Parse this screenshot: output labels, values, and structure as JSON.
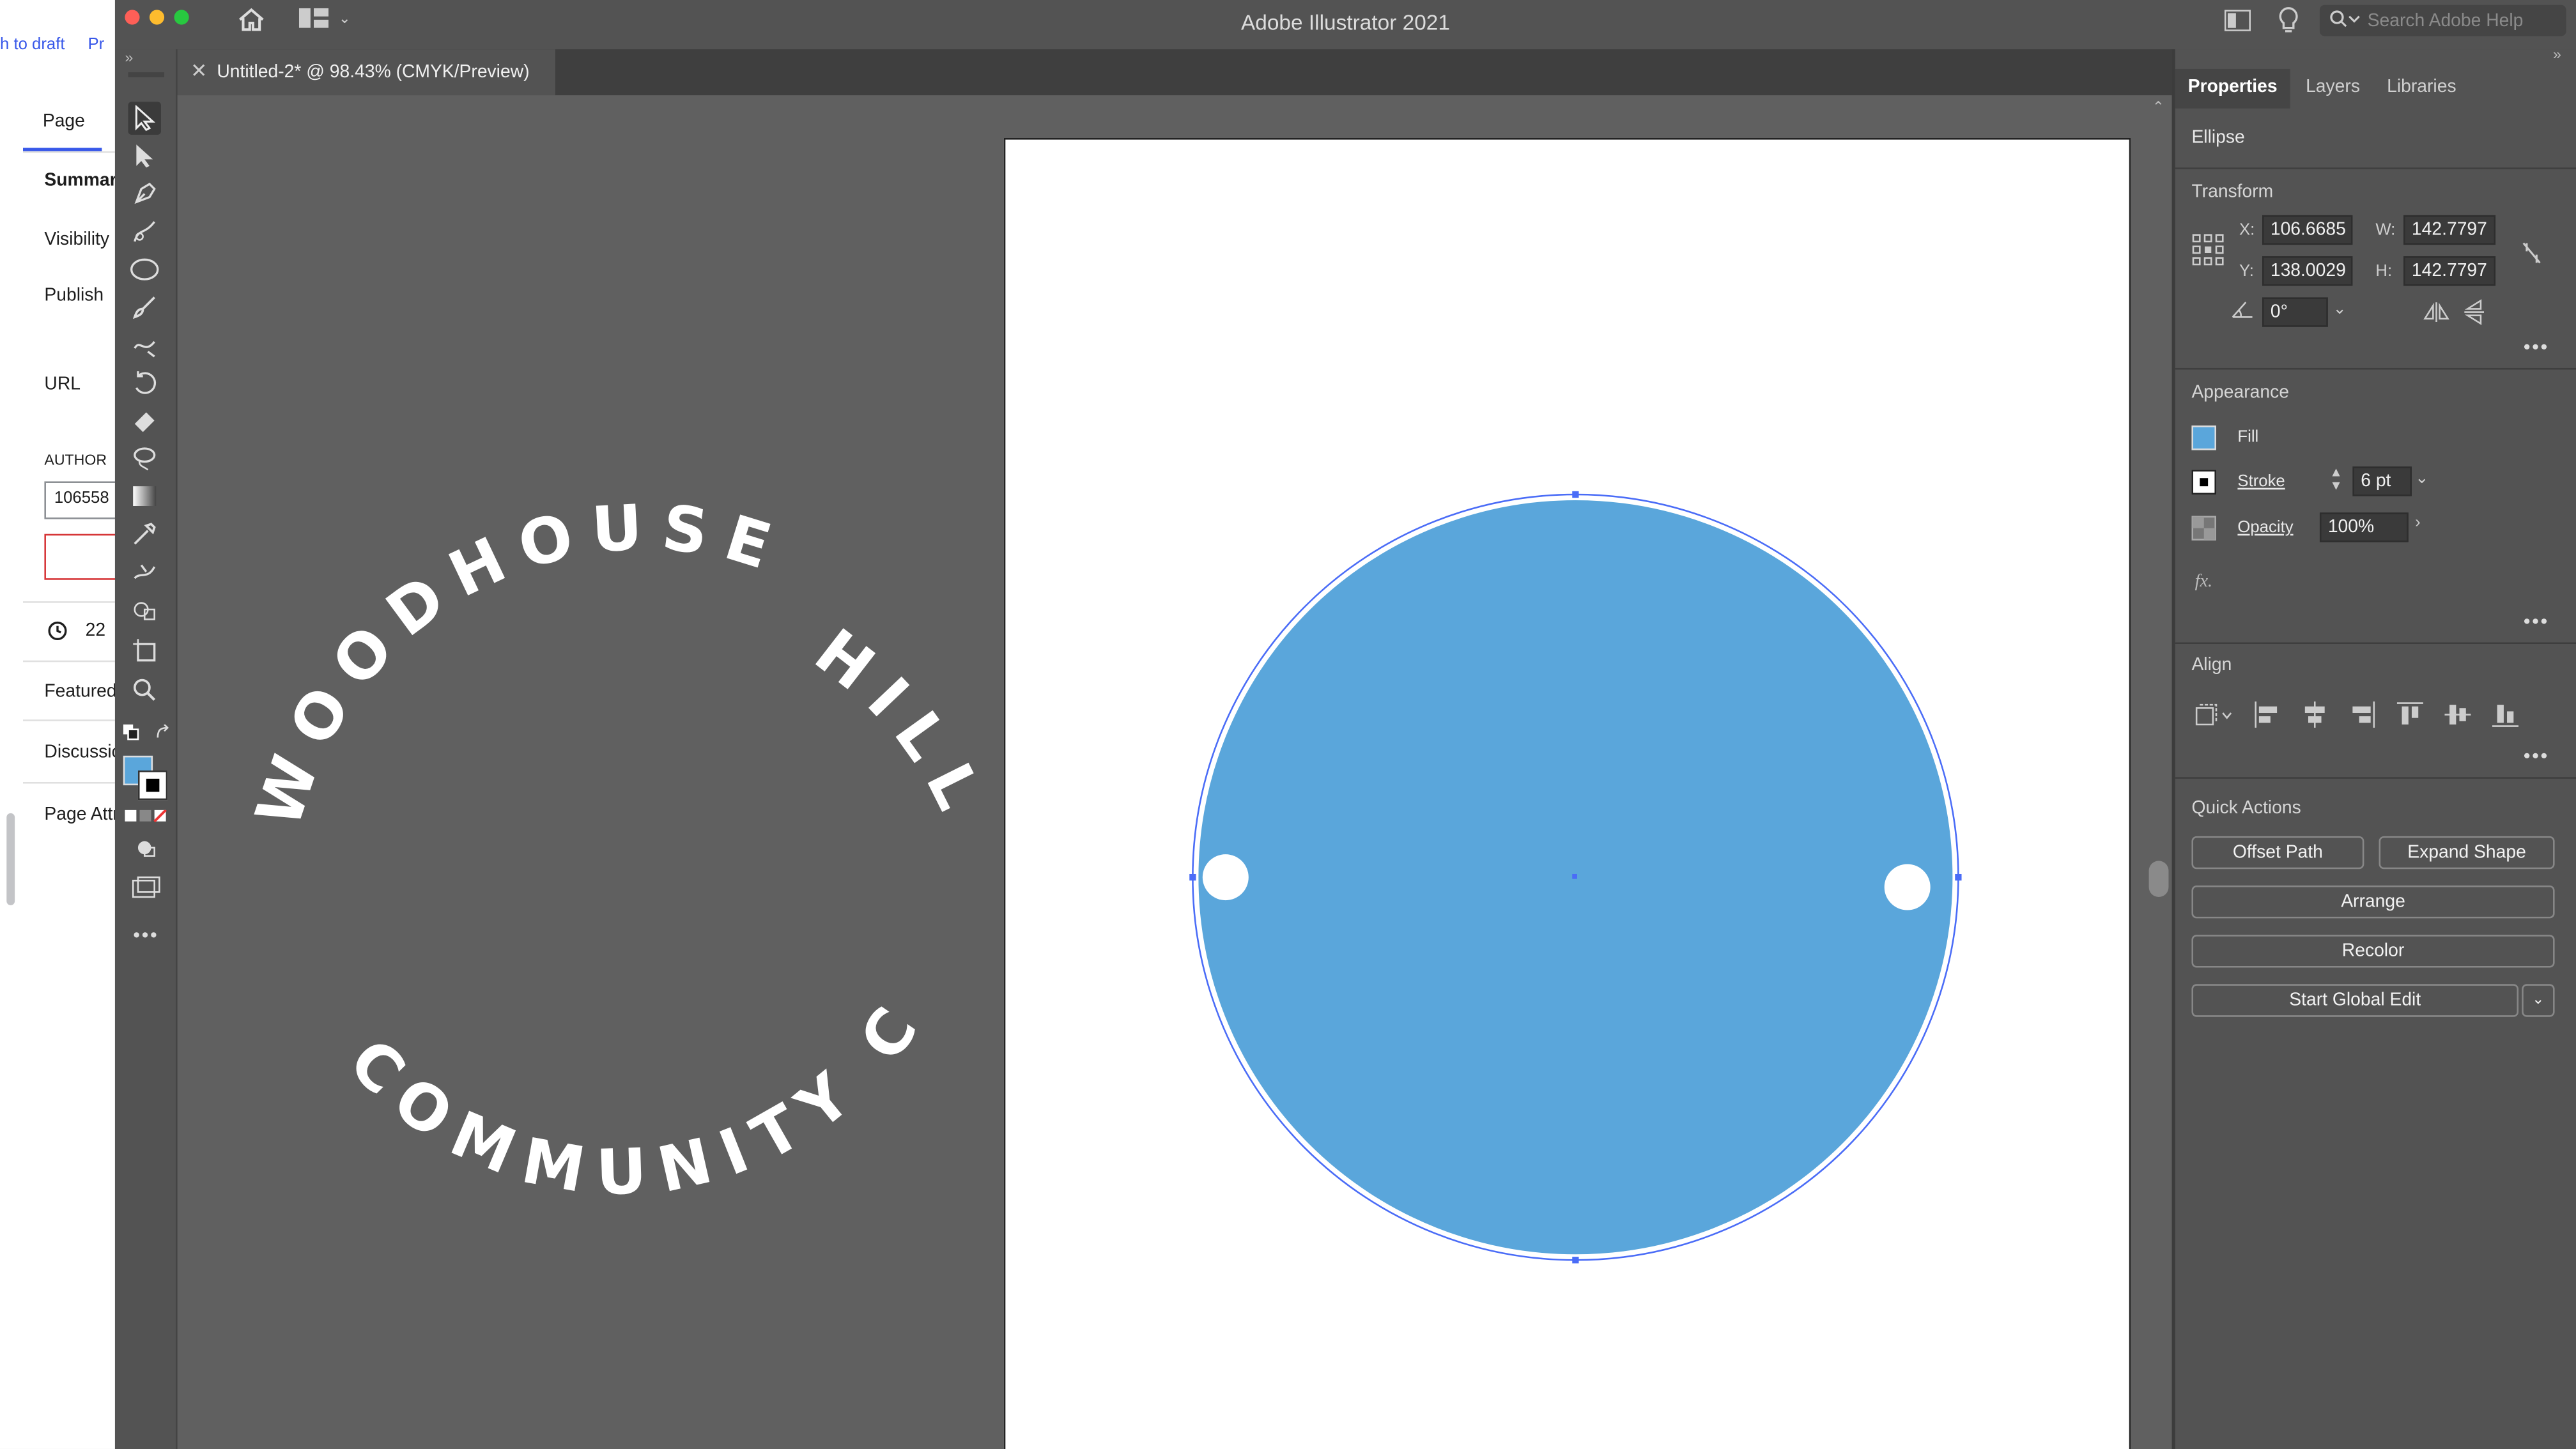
{
  "app": {
    "title": "Adobe Illustrator 2021",
    "search_placeholder": "Search Adobe Help",
    "document_tab": "Untitled-2* @ 98.43% (CMYK/Preview)",
    "workspace_caret": "⌄"
  },
  "wordpress_sidebar": {
    "top_links": [
      "h to draft",
      "Pr"
    ],
    "tab": "Page",
    "rows": [
      "Summary",
      "Visibility",
      "Publish",
      "URL",
      "AUTHOR",
      "22",
      "Featured",
      "Discussion",
      "Page Attr"
    ],
    "author_value": "106558"
  },
  "tools": [
    "selection-tool",
    "direct-selection-tool",
    "pen-tool",
    "curvature-tool",
    "ellipse-tool",
    "paintbrush-tool",
    "shaper-tool",
    "rotate-tool",
    "eraser-tool",
    "lasso-tool",
    "gradient-tool",
    "eyedropper-tool",
    "width-tool",
    "shape-builder-tool",
    "artboard-tool",
    "zoom-tool"
  ],
  "artwork": {
    "top_text": "WOODHOUSE",
    "right_text": "HILL",
    "bottom_text": "COMMUNITY CLUB",
    "circle_fill": "#5AA6DB",
    "selection_color": "#4a6cf7"
  },
  "properties_panel": {
    "tabs": [
      "Properties",
      "Layers",
      "Libraries"
    ],
    "object_type": "Ellipse",
    "transform": {
      "heading": "Transform",
      "x_label": "X:",
      "x_value": "106.6685",
      "y_label": "Y:",
      "y_value": "138.0029",
      "w_label": "W:",
      "w_value": "142.7797",
      "h_label": "H:",
      "h_value": "142.7797",
      "angle_value": "0°"
    },
    "appearance": {
      "heading": "Appearance",
      "fill_label": "Fill",
      "fill_color": "#5AA6DB",
      "stroke_label": "Stroke",
      "stroke_value": "6 pt",
      "opacity_label": "Opacity",
      "opacity_value": "100%",
      "fx_label": "fx."
    },
    "align": {
      "heading": "Align"
    },
    "quick_actions": {
      "heading": "Quick Actions",
      "offset_path": "Offset Path",
      "expand_shape": "Expand Shape",
      "arrange": "Arrange",
      "recolor": "Recolor",
      "start_global_edit": "Start Global Edit"
    }
  }
}
